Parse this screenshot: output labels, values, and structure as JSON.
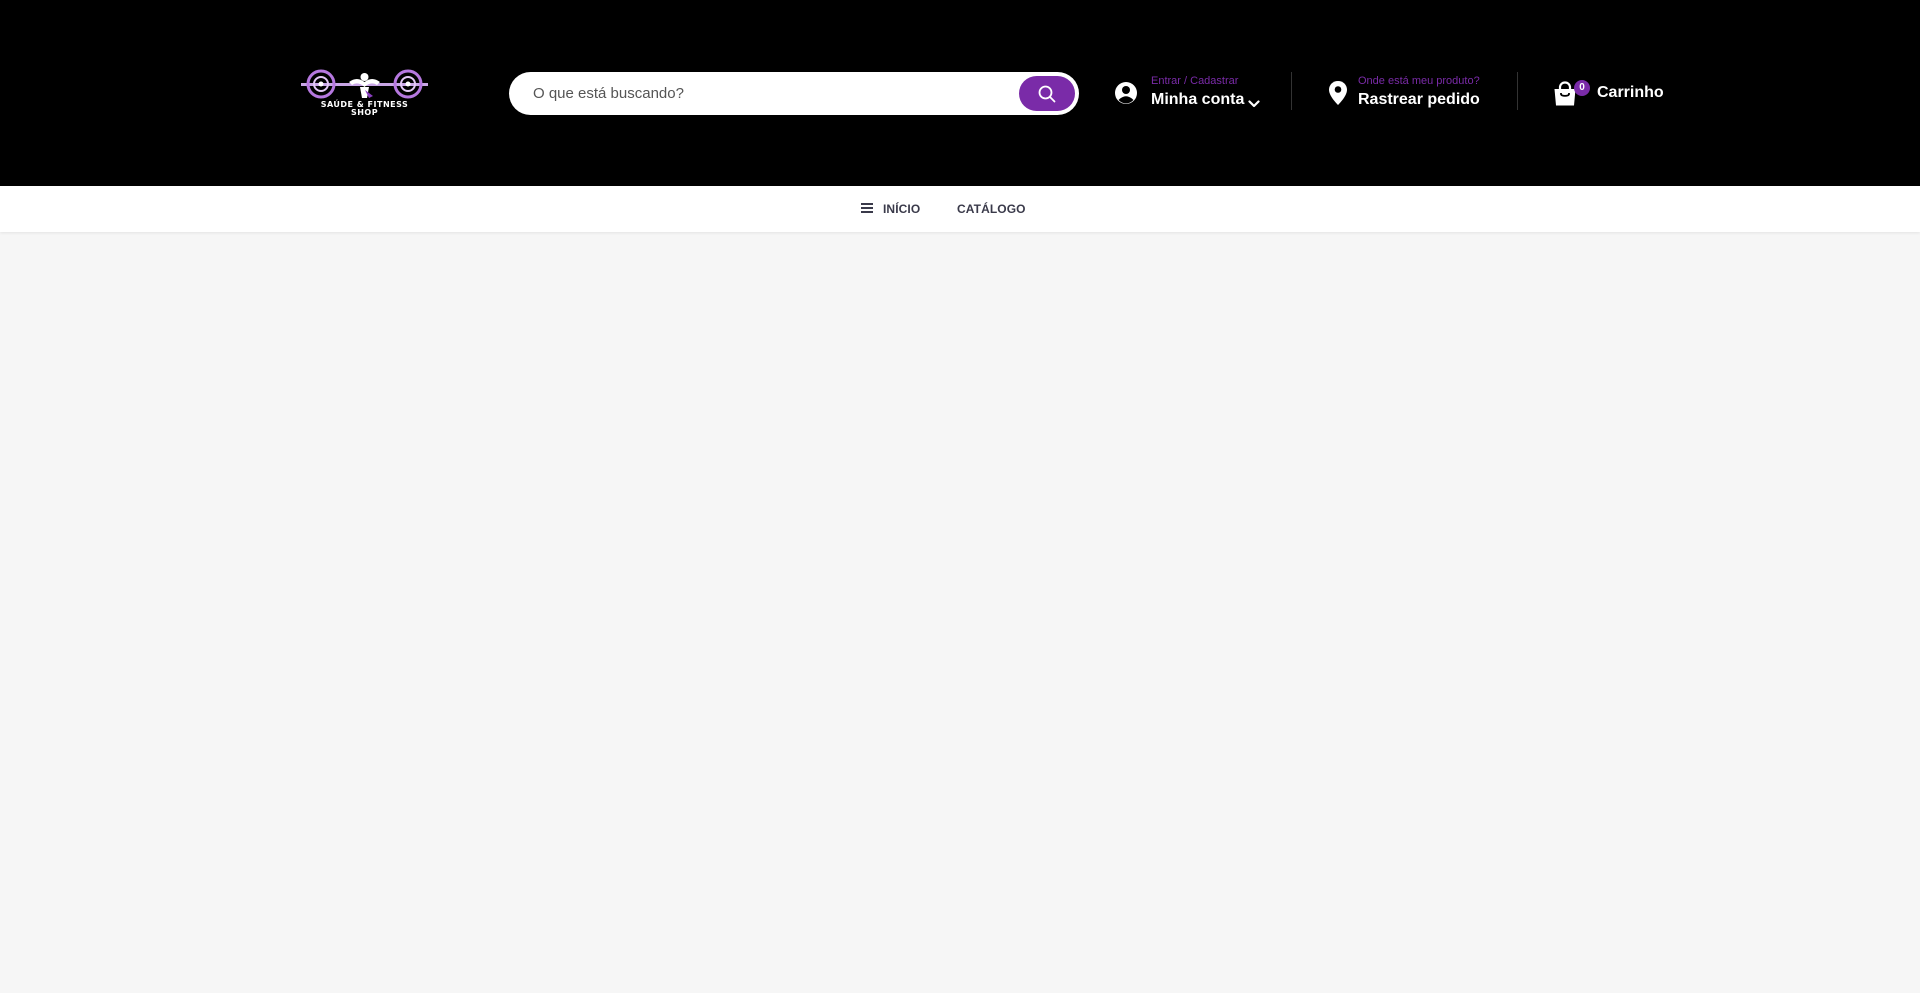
{
  "brand": {
    "logo_text_line1": "SAÚDE & FITNESS",
    "logo_text_line2": "SHOP",
    "accent_color": "#7a2ba8"
  },
  "search": {
    "placeholder": "O que está buscando?",
    "value": "",
    "button_icon": "search-icon"
  },
  "account": {
    "small_label": "Entrar / Cadastrar",
    "label": "Minha conta",
    "icon": "user-circle-icon"
  },
  "track": {
    "small_label": "Onde está meu produto?",
    "label": "Rastrear pedido",
    "icon": "map-pin-icon"
  },
  "cart": {
    "count": "0",
    "label": "Carrinho",
    "icon": "shopping-bag-icon"
  },
  "nav": {
    "items": [
      {
        "label": "INÍCIO",
        "icon": "menu-icon"
      },
      {
        "label": "CATÁLOGO"
      }
    ]
  }
}
